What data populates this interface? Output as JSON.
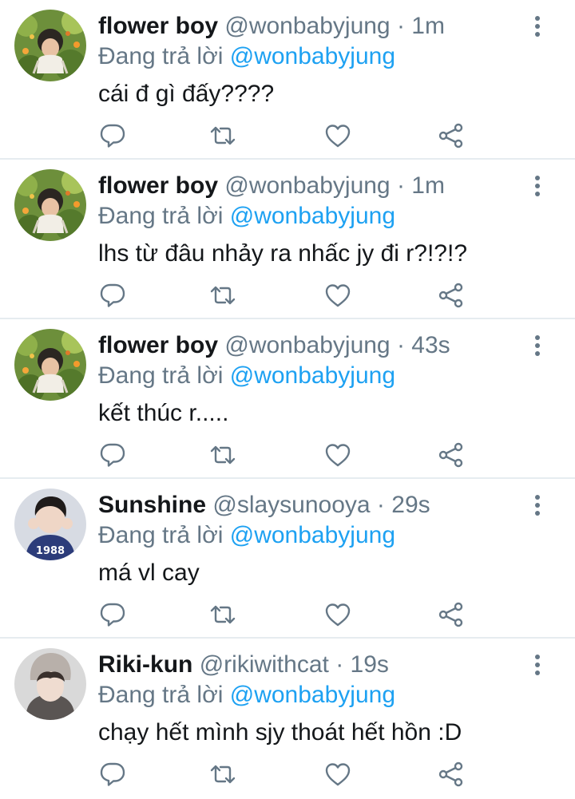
{
  "colors": {
    "link": "#1da1f2",
    "muted": "#657786",
    "text": "#14171a",
    "divider": "#e6ecf0"
  },
  "icons": {
    "reply": "reply-icon",
    "retweet": "retweet-icon",
    "like": "heart-icon",
    "share": "share-icon",
    "more": "more-vertical-icon"
  },
  "tweets": [
    {
      "name": "flower boy",
      "handle": "@wonbabyjung",
      "sep": " · ",
      "time": "1m",
      "reply_prefix": "Đang trả lời ",
      "reply_to": "@wonbabyjung",
      "text": "cái đ gì đấy????"
    },
    {
      "name": "flower boy",
      "handle": "@wonbabyjung",
      "sep": " · ",
      "time": "1m",
      "reply_prefix": "Đang trả lời ",
      "reply_to": "@wonbabyjung",
      "text": "lhs từ đâu nhảy ra nhấc jy đi r?!?!?"
    },
    {
      "name": "flower boy",
      "handle": "@wonbabyjung",
      "sep": " · ",
      "time": "43s",
      "reply_prefix": "Đang trả lời ",
      "reply_to": "@wonbabyjung",
      "text": "kết thúc r....."
    },
    {
      "name": "Sunshine",
      "handle": "@slaysunooya",
      "sep": " · ",
      "time": "29s",
      "reply_prefix": "Đang trả lời ",
      "reply_to": "@wonbabyjung",
      "text": "má vl cay",
      "avatar_text": "1988"
    },
    {
      "name": "Riki-kun",
      "handle": "@rikiwithcat",
      "sep": " · ",
      "time": "19s",
      "reply_prefix": "Đang trả lời ",
      "reply_to": "@wonbabyjung",
      "text": "chạy hết mình sjy thoát hết hồn :D"
    }
  ]
}
